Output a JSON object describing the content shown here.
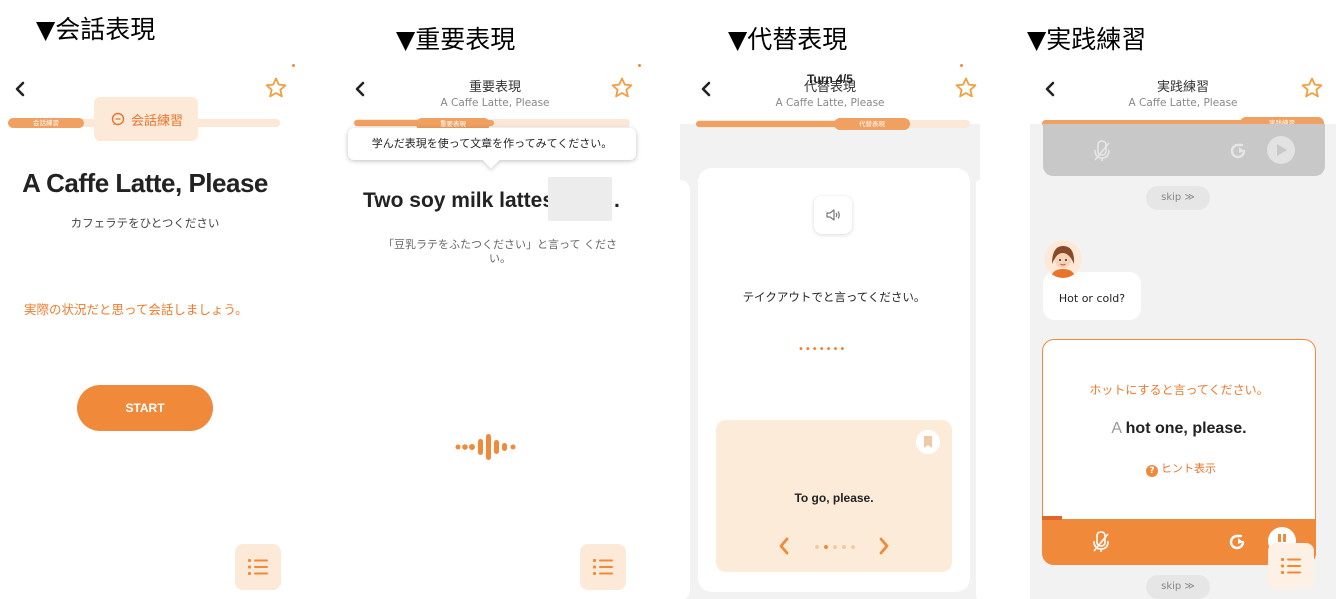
{
  "sections": [
    {
      "title": "▼会話表現"
    },
    {
      "title": "▼重要表現"
    },
    {
      "title": "▼代替表現"
    },
    {
      "title": "▼実践練習"
    }
  ],
  "screen1": {
    "progress_label": "会話練習",
    "chip_label": "会話練習",
    "title": "A Caffe Latte, Please",
    "subtitle": "カフェラテをひとつください",
    "instruction": "実際の状況だと思って会話しましょう。",
    "start_label": "START"
  },
  "screen2": {
    "header_title": "重要表現",
    "header_subtitle": "A Caffe Latte, Please",
    "progress_label": "重要表現",
    "tooltip": "学んだ表現を使って文章を作ってみてください。",
    "sentence": "Two soy milk lattes,",
    "sentence_end": ".",
    "hint": "「豆乳ラテをふたつください」と言って ください。"
  },
  "screen3": {
    "header_title": "代替表現",
    "header_subtitle": "A Caffe Latte, Please",
    "progress_label": "代替表現",
    "turn": "Turn  4/5",
    "prompt": "テイクアウトでと言ってください。",
    "masked": "•••••••",
    "answer": "To go, please.",
    "page_count": 5,
    "page_current": 1
  },
  "screen4": {
    "header_title": "実践練習",
    "header_subtitle": "A Caffe Latte, Please",
    "progress_label": "実践練習",
    "skip_label": "skip ≫",
    "bubble": "Hot or cold?",
    "prompt": "ホットにすると言ってください。",
    "answer_prefix": "A",
    "answer_main": "hot one, please.",
    "hint_label": "ヒント表示",
    "hint_icon": "?"
  },
  "colors": {
    "accent": "#f08a3a",
    "accent_light": "#fde9d7",
    "progress_track": "#fbe8d6",
    "progress_fill": "#f0a060",
    "screen_grey": "#f2f2f2"
  }
}
